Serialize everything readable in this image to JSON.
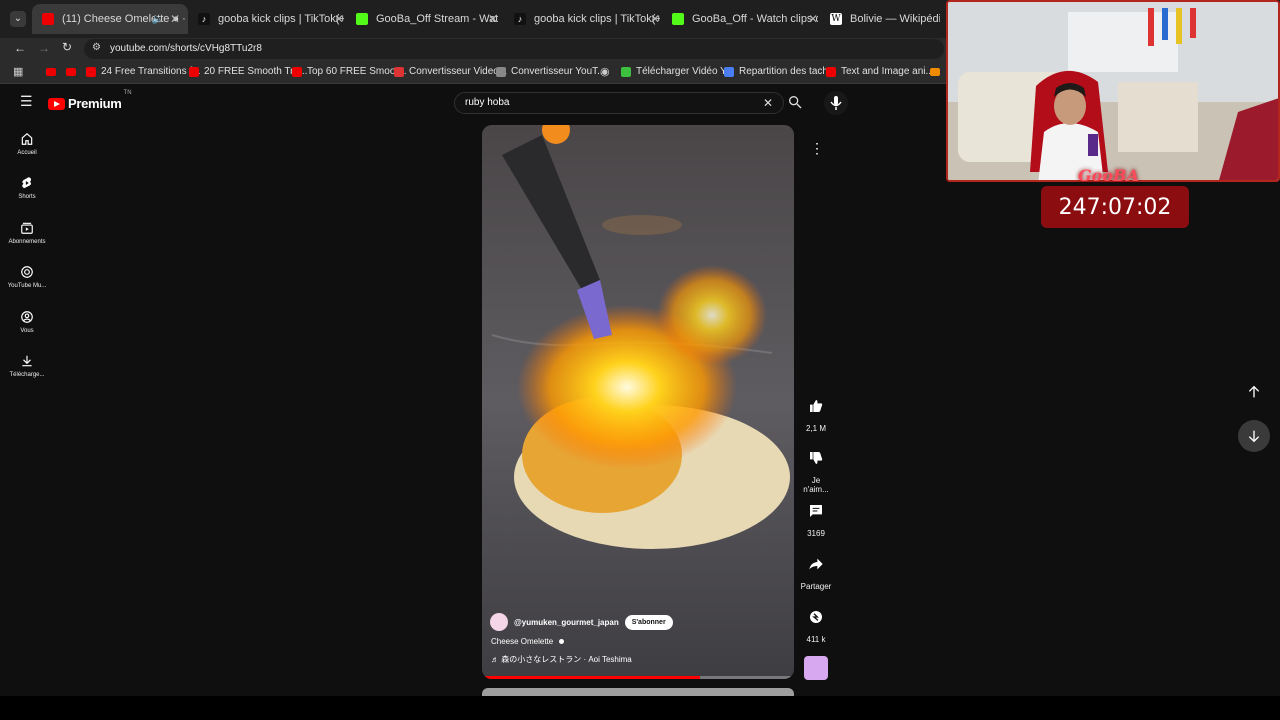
{
  "browser": {
    "tabs": [
      {
        "title": "(11) Cheese Omelette ● · Y",
        "active": true
      },
      {
        "title": "gooba kick clips | TikTok(+99)"
      },
      {
        "title": "GooBa_Off Stream - Watch Live"
      },
      {
        "title": "gooba kick clips | TikTok(+99)"
      },
      {
        "title": "GooBa_Off - Watch clips on Kic"
      },
      {
        "title": "Bolivie — Wikipédia"
      }
    ],
    "url": "youtube.com/shorts/cVHg8TTu2r8",
    "bookmarks": [
      "24 Free Transitions f...",
      "20 FREE Smooth Tra...",
      "Top 60 FREE Smoot...",
      "Convertisseur Video...",
      "Convertisseur YouT...",
      "Télécharger Vidéo Y...",
      "Repartition des tach...",
      "Text and Image ani..."
    ]
  },
  "youtube": {
    "logo": "Premium",
    "logo_sup": "TN",
    "search_value": "ruby hoba",
    "sidebar": [
      "Accueil",
      "Shorts",
      "Abonnements",
      "YouTube Mu...",
      "Vous",
      "Télécharge..."
    ],
    "short": {
      "channel": "@yumuken_gourmet_japan",
      "subscribe": "S'abonner",
      "title": "Cheese Omelette",
      "music": "♬ 森の小さなレストラン · Aoi Teshima",
      "progress": 0.7
    },
    "actions": {
      "likes": "2,1 M",
      "dislike": "Je n'aim...",
      "comments": "3169",
      "share": "Partager",
      "remix": "411 k"
    }
  },
  "overlay": {
    "streamer": "GooBA",
    "timer": "247:07:02"
  }
}
